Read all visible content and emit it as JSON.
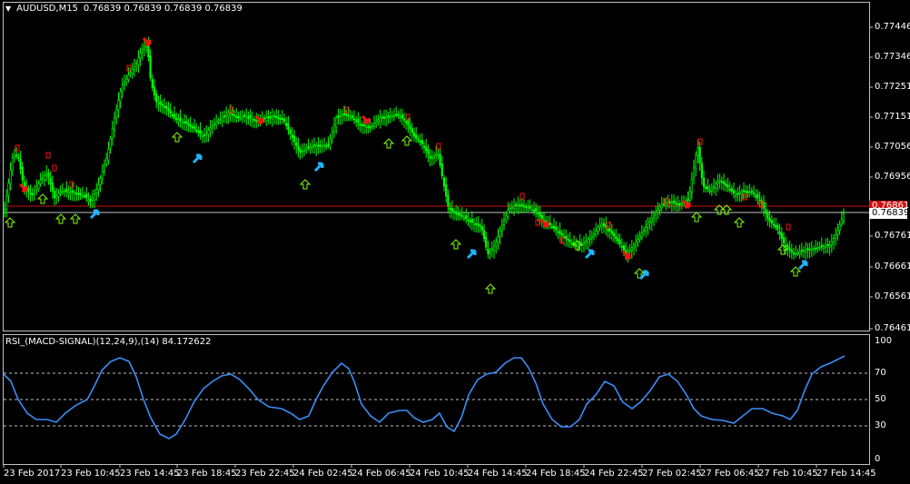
{
  "header": {
    "symbol": "AUDUSD,M15",
    "ohlc": "0.76839 0.76839 0.76839 0.76839"
  },
  "price_axis": {
    "labels": [
      "0.77446",
      "0.77346",
      "0.77251",
      "0.77151",
      "0.77056",
      "0.76956",
      "0.76761",
      "0.76661",
      "0.76561",
      "0.76461"
    ],
    "current_price": "0.76839",
    "ask_price": "0.76861"
  },
  "rsi_panel": {
    "title": "RSI_(MACD-SIGNAL)(12,24,9),(14) 84.172622",
    "levels": [
      "100",
      "70",
      "50",
      "30",
      "0"
    ]
  },
  "time_axis": {
    "labels": [
      "23 Feb 2017",
      "23 Feb 10:45",
      "23 Feb 14:45",
      "23 Feb 18:45",
      "23 Feb 22:45",
      "24 Feb 02:45",
      "24 Feb 06:45",
      "24 Feb 10:45",
      "24 Feb 14:45",
      "24 Feb 18:45",
      "24 Feb 22:45",
      "27 Feb 02:45",
      "27 Feb 06:45",
      "27 Feb 10:45",
      "27 Feb 14:45"
    ]
  },
  "colors": {
    "candle": "#00ff00",
    "rsi_line": "#3a8ef6",
    "bid_line": "#c0c0c0",
    "ask_line": "#d01010",
    "up_arrow": "#7fff00",
    "down_arrow": "#ff1010",
    "blue_arrow": "#1eb4ff"
  }
}
